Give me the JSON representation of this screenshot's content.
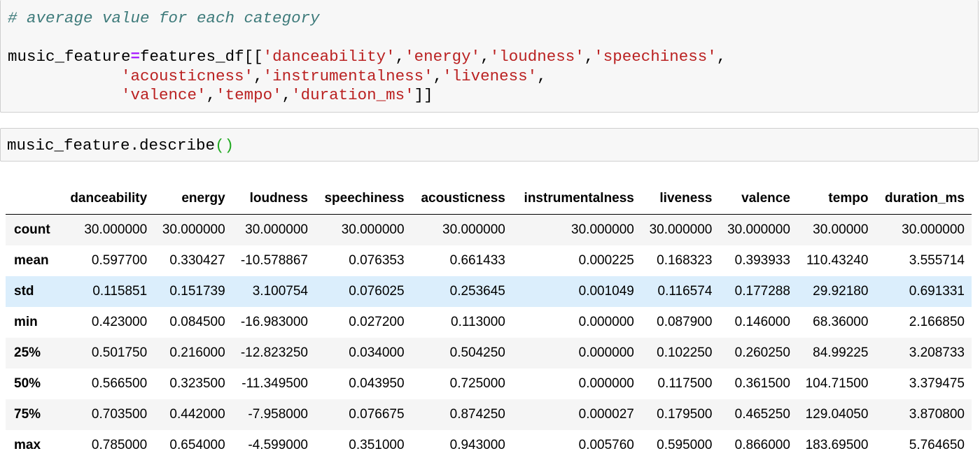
{
  "cell1": {
    "comment": "# average value for each category",
    "var_name": "music_feature",
    "assign_op": "=",
    "df_name": "features_df",
    "open_brackets": "[[",
    "close_brackets": "]]",
    "columns": [
      "'danceability'",
      "'energy'",
      "'loudness'",
      "'speechiness'",
      "'acousticness'",
      "'instrumentalness'",
      "'liveness'",
      "'valence'",
      "'tempo'",
      "'duration_ms'"
    ],
    "comma": ","
  },
  "cell2": {
    "call": "music_feature.describe",
    "parens": "()"
  },
  "table": {
    "corner": "",
    "columns": [
      "danceability",
      "energy",
      "loudness",
      "speechiness",
      "acousticness",
      "instrumentalness",
      "liveness",
      "valence",
      "tempo",
      "duration_ms"
    ],
    "rows": [
      {
        "label": "count",
        "values": [
          "30.000000",
          "30.000000",
          "30.000000",
          "30.000000",
          "30.000000",
          "30.000000",
          "30.000000",
          "30.000000",
          "30.00000",
          "30.000000"
        ]
      },
      {
        "label": "mean",
        "values": [
          "0.597700",
          "0.330427",
          "-10.578867",
          "0.076353",
          "0.661433",
          "0.000225",
          "0.168323",
          "0.393933",
          "110.43240",
          "3.555714"
        ]
      },
      {
        "label": "std",
        "values": [
          "0.115851",
          "0.151739",
          "3.100754",
          "0.076025",
          "0.253645",
          "0.001049",
          "0.116574",
          "0.177288",
          "29.92180",
          "0.691331"
        ]
      },
      {
        "label": "min",
        "values": [
          "0.423000",
          "0.084500",
          "-16.983000",
          "0.027200",
          "0.113000",
          "0.000000",
          "0.087900",
          "0.146000",
          "68.36000",
          "2.166850"
        ]
      },
      {
        "label": "25%",
        "values": [
          "0.501750",
          "0.216000",
          "-12.823250",
          "0.034000",
          "0.504250",
          "0.000000",
          "0.102250",
          "0.260250",
          "84.99225",
          "3.208733"
        ]
      },
      {
        "label": "50%",
        "values": [
          "0.566500",
          "0.323500",
          "-11.349500",
          "0.043950",
          "0.725000",
          "0.000000",
          "0.117500",
          "0.361500",
          "104.71500",
          "3.379475"
        ]
      },
      {
        "label": "75%",
        "values": [
          "0.703500",
          "0.442000",
          "-7.958000",
          "0.076675",
          "0.874250",
          "0.000027",
          "0.179500",
          "0.465250",
          "129.04050",
          "3.870800"
        ]
      },
      {
        "label": "max",
        "values": [
          "0.785000",
          "0.654000",
          "-4.599000",
          "0.351000",
          "0.943000",
          "0.005760",
          "0.595000",
          "0.866000",
          "183.69500",
          "5.764650"
        ]
      }
    ],
    "highlighted_row": "std"
  }
}
